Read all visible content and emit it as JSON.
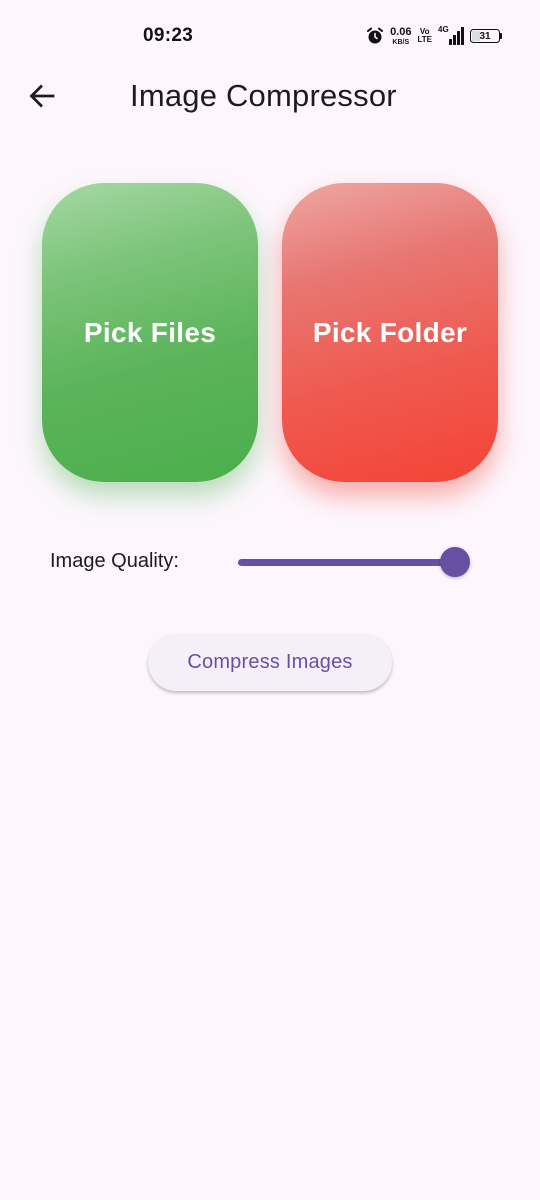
{
  "status_bar": {
    "time": "09:23",
    "icons": [
      "alarm-icon",
      "network-speed-indicator",
      "volte-icon",
      "signal-icon",
      "battery-icon"
    ],
    "net_speed_value": "0.06",
    "net_speed_unit": "KB/S",
    "volte_top": "Vo",
    "volte_bottom": "LTE",
    "network_type": "4G",
    "battery_level": "31"
  },
  "app_bar": {
    "back_icon": "arrow-left-icon",
    "title": "Image Compressor"
  },
  "actions": {
    "pick_files_label": "Pick Files",
    "pick_files_color": "#4caf50",
    "pick_folder_label": "Pick Folder",
    "pick_folder_color": "#f44336"
  },
  "quality": {
    "label": "Image Quality:",
    "value": 1.0,
    "accent_color": "#6750a4"
  },
  "compress_button": {
    "label": "Compress Images"
  }
}
